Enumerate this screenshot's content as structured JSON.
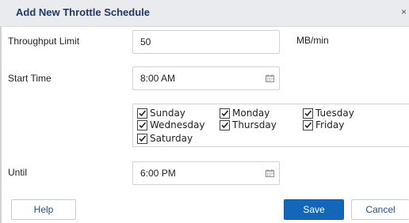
{
  "dialog": {
    "title": "Add New Throttle Schedule",
    "close_glyph": "×"
  },
  "form": {
    "throughput": {
      "label": "Throughput Limit",
      "value": "50",
      "unit": "MB/min"
    },
    "start_time": {
      "label": "Start Time",
      "value": "8:00 AM",
      "icon": "calendar-icon"
    },
    "days": [
      {
        "label": "Sunday",
        "checked": true
      },
      {
        "label": "Monday",
        "checked": true
      },
      {
        "label": "Tuesday",
        "checked": true
      },
      {
        "label": "Wednesday",
        "checked": true
      },
      {
        "label": "Thursday",
        "checked": true
      },
      {
        "label": "Friday",
        "checked": true
      },
      {
        "label": "Saturday",
        "checked": true
      }
    ],
    "until": {
      "label": "Until",
      "value": "6:00 PM",
      "icon": "calendar-icon"
    }
  },
  "buttons": {
    "help": "Help",
    "save": "Save",
    "cancel": "Cancel"
  },
  "colors": {
    "title": "#1e3a66",
    "primary_button": "#1466b8",
    "link_text": "#1e4e8c"
  }
}
